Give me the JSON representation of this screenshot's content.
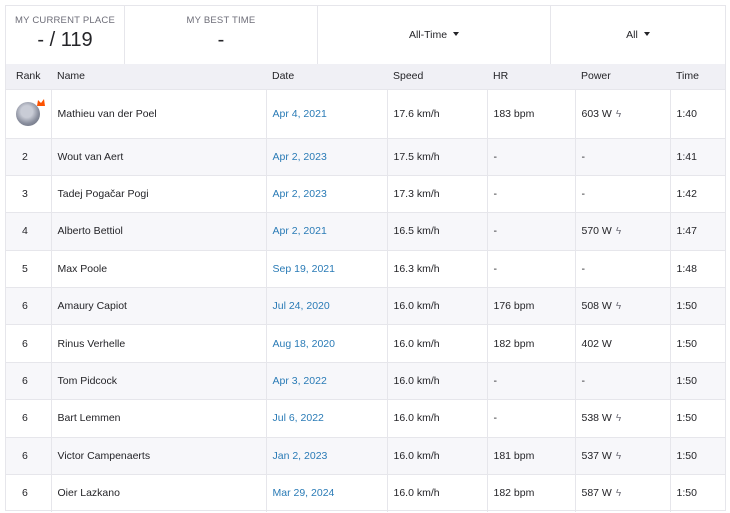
{
  "header": {
    "current_place_label": "MY CURRENT PLACE",
    "current_place_value": "- / 119",
    "best_time_label": "MY BEST TIME",
    "best_time_value": "-",
    "date_filter": "All-Time",
    "group_filter": "All"
  },
  "table": {
    "columns": [
      "Rank",
      "Name",
      "Date",
      "Speed",
      "HR",
      "Power",
      "Time"
    ],
    "rows": [
      {
        "rank": "",
        "name": "Mathieu van der Poel",
        "date": "Apr 4, 2021",
        "speed": "17.6 km/h",
        "hr": "183 bpm",
        "power": "603 W",
        "bolt": true,
        "time": "1:40"
      },
      {
        "rank": "2",
        "name": "Wout van Aert",
        "date": "Apr 2, 2023",
        "speed": "17.5 km/h",
        "hr": "-",
        "power": "-",
        "bolt": false,
        "time": "1:41"
      },
      {
        "rank": "3",
        "name": "Tadej Pogačar Pogi",
        "date": "Apr 2, 2023",
        "speed": "17.3 km/h",
        "hr": "-",
        "power": "-",
        "bolt": false,
        "time": "1:42"
      },
      {
        "rank": "4",
        "name": "Alberto Bettiol",
        "date": "Apr 2, 2021",
        "speed": "16.5 km/h",
        "hr": "-",
        "power": "570 W",
        "bolt": true,
        "time": "1:47"
      },
      {
        "rank": "5",
        "name": "Max Poole",
        "date": "Sep 19, 2021",
        "speed": "16.3 km/h",
        "hr": "-",
        "power": "-",
        "bolt": false,
        "time": "1:48"
      },
      {
        "rank": "6",
        "name": "Amaury Capiot",
        "date": "Jul 24, 2020",
        "speed": "16.0 km/h",
        "hr": "176 bpm",
        "power": "508 W",
        "bolt": true,
        "time": "1:50"
      },
      {
        "rank": "6",
        "name": "Rinus Verhelle",
        "date": "Aug 18, 2020",
        "speed": "16.0 km/h",
        "hr": "182 bpm",
        "power": "402 W",
        "bolt": false,
        "time": "1:50"
      },
      {
        "rank": "6",
        "name": "Tom Pidcock",
        "date": "Apr 3, 2022",
        "speed": "16.0 km/h",
        "hr": "-",
        "power": "-",
        "bolt": false,
        "time": "1:50"
      },
      {
        "rank": "6",
        "name": "Bart Lemmen",
        "date": "Jul 6, 2022",
        "speed": "16.0 km/h",
        "hr": "-",
        "power": "538 W",
        "bolt": true,
        "time": "1:50"
      },
      {
        "rank": "6",
        "name": "Victor Campenaerts",
        "date": "Jan 2, 2023",
        "speed": "16.0 km/h",
        "hr": "181 bpm",
        "power": "537 W",
        "bolt": true,
        "time": "1:50"
      },
      {
        "rank": "6",
        "name": "Oier Lazkano",
        "date": "Mar 29, 2024",
        "speed": "16.0 km/h",
        "hr": "182 bpm",
        "power": "587 W",
        "bolt": true,
        "time": "1:50"
      }
    ]
  },
  "colors": {
    "link": "#2a7bb6",
    "header_bg": "#f0f0f5",
    "border": "#e6e6eb",
    "crown": "#fc5200"
  },
  "icons": {
    "bolt": "bolt-icon",
    "crown": "crown-icon",
    "caret": "caret-down-icon"
  }
}
